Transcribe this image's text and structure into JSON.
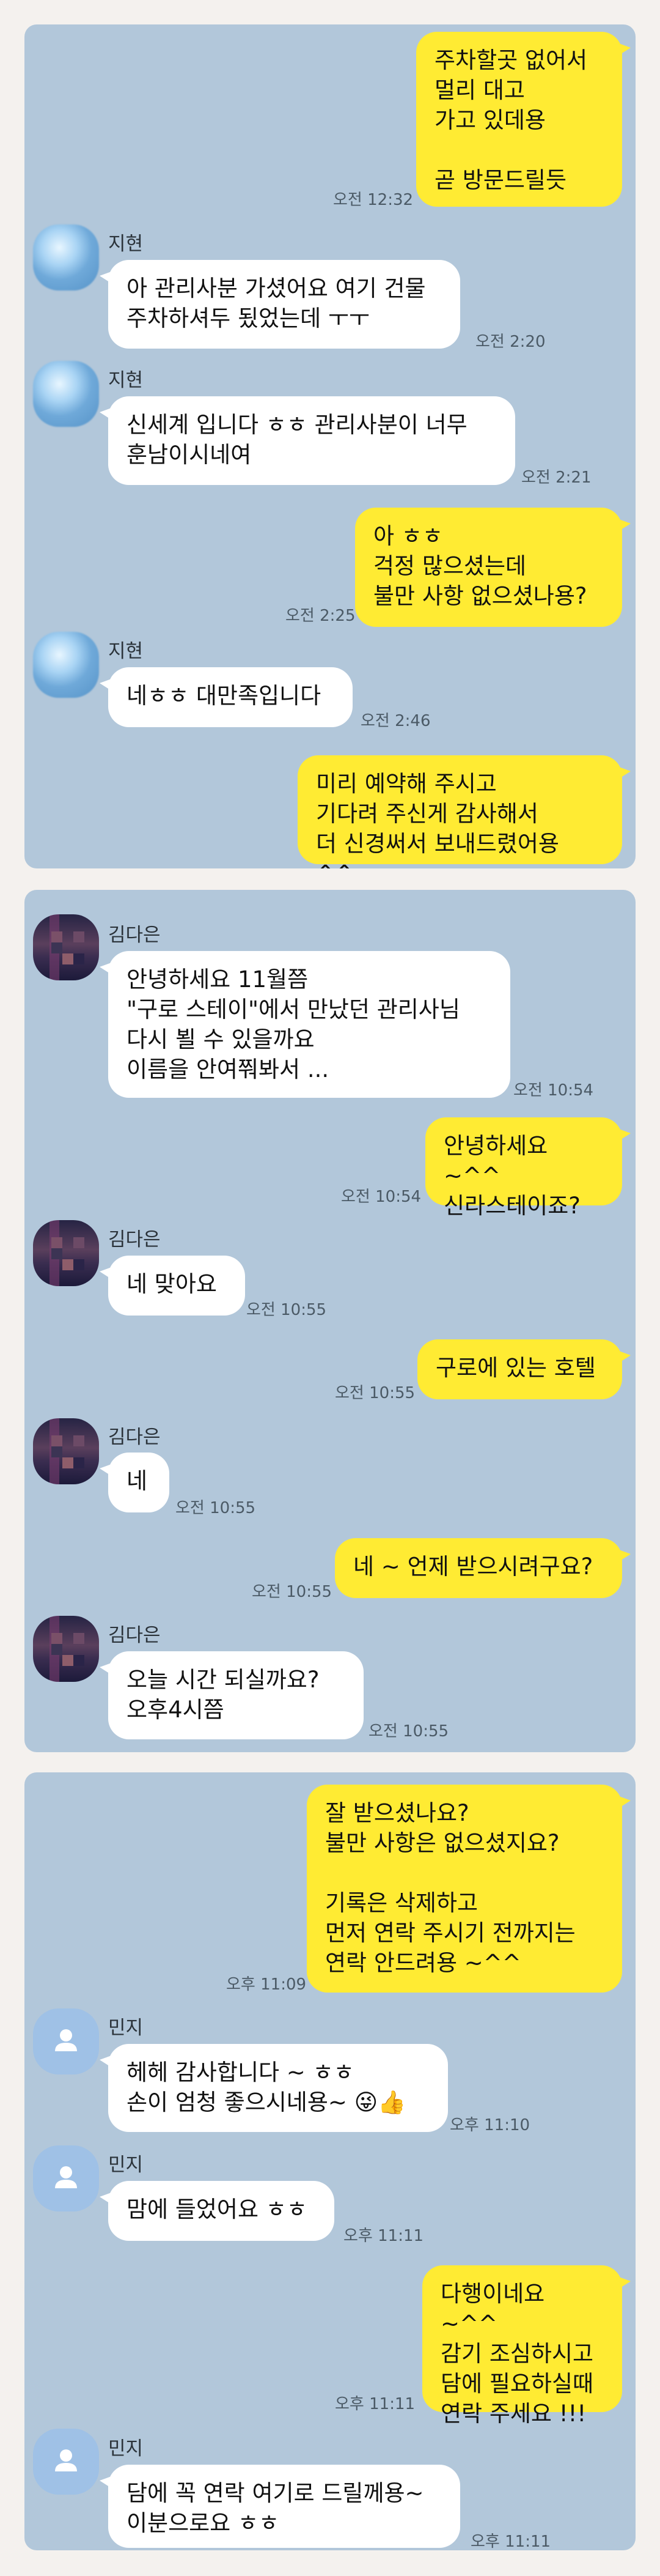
{
  "panel1": {
    "messages": [
      {
        "text": "주차할곳 없어서\n멀리 대고\n가고 있데용\n\n곧 방문드릴듯",
        "time": "오전 12:32"
      },
      {
        "sender": "지현",
        "text": "아 관리사분 가셨어요 여기 건물\n주차하셔두 됬었는데 ㅜㅜ",
        "time": "오전 2:20"
      },
      {
        "sender": "지현",
        "text": "신세계 입니다 ㅎㅎ 관리사분이 너무\n훈남이시네여",
        "time": "오전 2:21"
      },
      {
        "text": "아 ㅎㅎ\n걱정 많으셨는데\n불만 사항 없으셨나용?",
        "time": "오전 2:25"
      },
      {
        "sender": "지현",
        "text": "네ㅎㅎ 대만족입니다",
        "time": "오전 2:46"
      },
      {
        "text": "미리 예약해 주시고\n기다려 주신게 감사해서\n더 신경써서 보내드렸어용 ^^"
      }
    ]
  },
  "panel2": {
    "messages": [
      {
        "sender": "김다은",
        "text": "안녕하세요 11월쯤\n\"구로 스테이\"에서 만났던 관리사님\n다시 뵐 수 있을까요\n이름을 안여쭤봐서 ...",
        "time": "오전 10:54"
      },
      {
        "text": "안녕하세요 ~^^\n신라스테이죠?",
        "time": "오전 10:54"
      },
      {
        "sender": "김다은",
        "text": "네 맞아요",
        "time": "오전 10:55"
      },
      {
        "text": "구로에 있는 호텔",
        "time": "오전 10:55"
      },
      {
        "sender": "김다은",
        "text": "네",
        "time": "오전 10:55"
      },
      {
        "text": "네 ~ 언제 받으시려구요?",
        "time": "오전 10:55"
      },
      {
        "sender": "김다은",
        "text": "오늘  시간 되실까요?\n오후4시쯤",
        "time": "오전 10:55"
      }
    ]
  },
  "panel3": {
    "messages": [
      {
        "text": "잘 받으셨나요?\n불만 사항은 없으셨지요?\n\n기록은 삭제하고\n먼저 연락 주시기 전까지는\n연락 안드려용 ~^^",
        "time": "오후 11:09"
      },
      {
        "sender": "민지",
        "text": "헤헤 감사합니다 ~ ㅎㅎ\n손이 엄청 좋으시네용~ 😜👍",
        "time": "오후 11:10"
      },
      {
        "sender": "민지",
        "text": "맘에 들었어요 ㅎㅎ",
        "time": "오후 11:11"
      },
      {
        "text": "다행이네요 ~^^\n감기 조심하시고\n담에 필요하실때\n연락 주세요 !!!",
        "time": "오후 11:11"
      },
      {
        "sender": "민지",
        "text": "담에 꼭 연락 여기로 드릴께용~\n이분으로요 ㅎㅎ",
        "time": "오후 11:11"
      }
    ]
  }
}
